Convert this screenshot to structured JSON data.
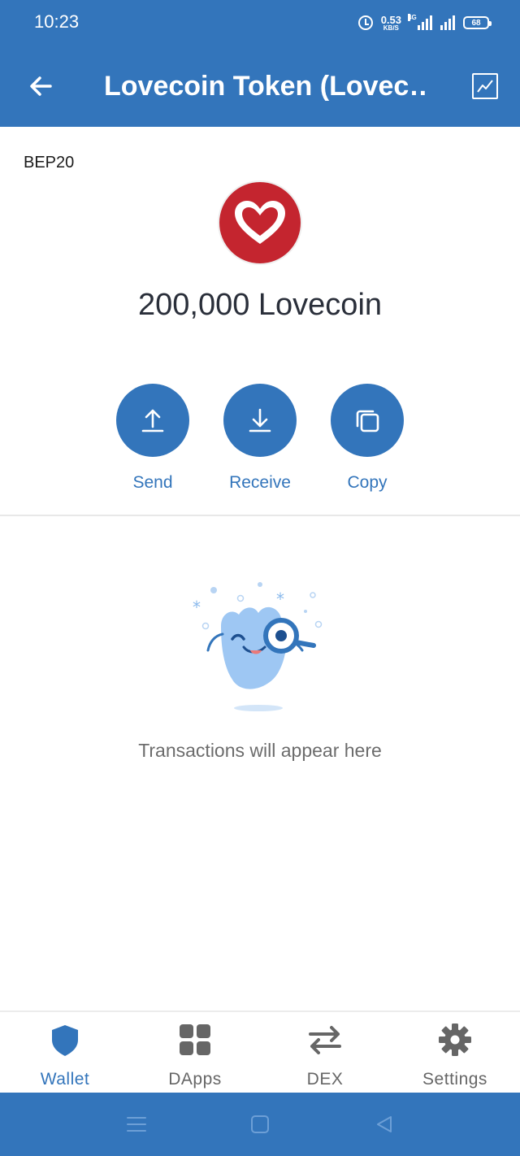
{
  "status_bar": {
    "time": "10:23",
    "net_speed_value": "0.53",
    "net_speed_unit": "KB/S",
    "network_type": "4G",
    "battery_level": "68"
  },
  "header": {
    "title": "Lovecoin Token (Lovec…",
    "back_icon": "arrow-left-icon",
    "chart_icon": "chart-line-icon"
  },
  "token": {
    "network": "BEP20",
    "balance": "200,000 Lovecoin",
    "logo_color": "#c4252f"
  },
  "actions": [
    {
      "label": "Send",
      "icon": "upload-icon"
    },
    {
      "label": "Receive",
      "icon": "download-icon"
    },
    {
      "label": "Copy",
      "icon": "copy-icon"
    }
  ],
  "empty_state": {
    "message": "Transactions will appear here"
  },
  "bottom_nav": [
    {
      "label": "Wallet",
      "icon": "shield-icon",
      "active": true
    },
    {
      "label": "DApps",
      "icon": "grid-icon",
      "active": false
    },
    {
      "label": "DEX",
      "icon": "swap-arrows-icon",
      "active": false
    },
    {
      "label": "Settings",
      "icon": "gear-icon",
      "active": false
    }
  ],
  "colors": {
    "primary": "#3375bb",
    "active_tab": "#3375bb",
    "inactive_tab": "#666666"
  }
}
